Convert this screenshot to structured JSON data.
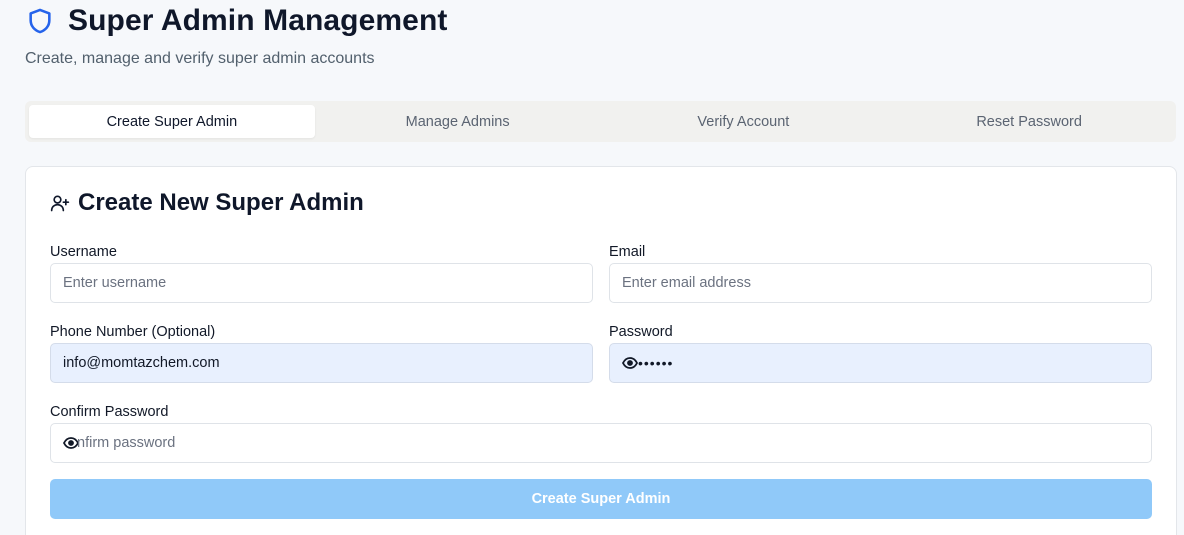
{
  "header": {
    "title": "Super Admin Management",
    "subtitle": "Create, manage and verify super admin accounts"
  },
  "tabs": [
    {
      "label": "Create Super Admin",
      "active": true
    },
    {
      "label": "Manage Admins",
      "active": false
    },
    {
      "label": "Verify Account",
      "active": false
    },
    {
      "label": "Reset Password",
      "active": false
    }
  ],
  "form": {
    "title": "Create New Super Admin",
    "username": {
      "label": "Username",
      "placeholder": "Enter username",
      "value": ""
    },
    "email": {
      "label": "Email",
      "placeholder": "Enter email address",
      "value": ""
    },
    "phone": {
      "label": "Phone Number (Optional)",
      "value": "info@momtazchem.com"
    },
    "password": {
      "label": "Password",
      "value_masked": "••••••"
    },
    "confirm_password": {
      "label": "Confirm Password",
      "placeholder_visible": "nfirm password"
    },
    "submit_label": "Create Super Admin"
  },
  "icons": {
    "title_icon": "shield-icon",
    "card_icon": "user-plus-icon",
    "password_toggle": "eye-icon"
  },
  "colors": {
    "accent": "#2563eb",
    "submit_disabled": "#90c9f9",
    "autofill_bg": "#e8f0fe"
  }
}
